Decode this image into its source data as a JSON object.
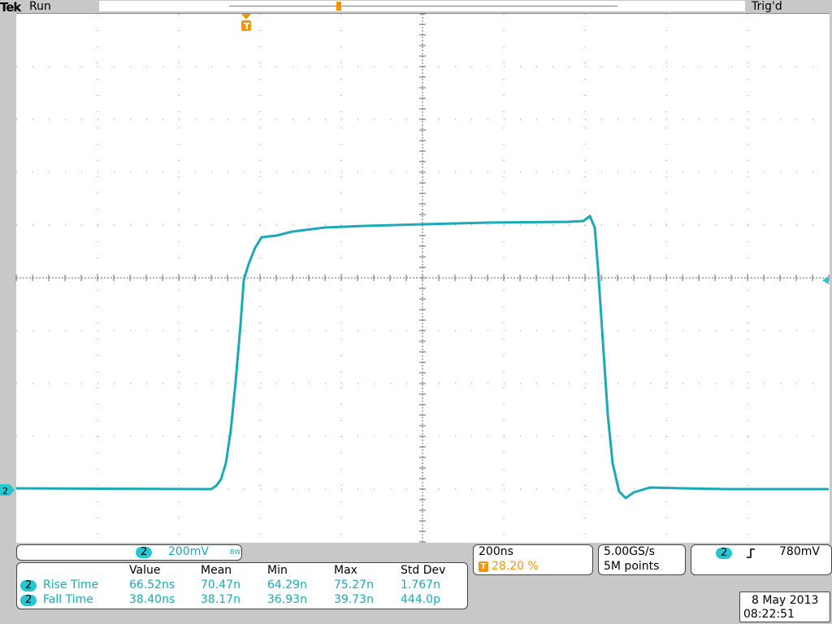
{
  "status": {
    "brand": "Tek",
    "run_state": "Run",
    "trigger_state": "Trig'd"
  },
  "trigger_marker": {
    "label": "T",
    "position_percent": 28.2
  },
  "channel": {
    "number": "2",
    "ground_label": "2",
    "volts_per_div": "200mV",
    "bw_label": "BW"
  },
  "timebase": {
    "per_div": "200ns",
    "trigger_position": "28.20 %"
  },
  "acquisition": {
    "sample_rate": "5.00GS/s",
    "record_length": "5M points"
  },
  "trigger": {
    "source": "2",
    "slope_icon": "rising-edge-icon",
    "level": "780mV"
  },
  "measurements": {
    "headers": [
      "Value",
      "Mean",
      "Min",
      "Max",
      "Std Dev"
    ],
    "rows": [
      {
        "channel": "2",
        "name": "Rise Time",
        "value": "66.52ns",
        "mean": "70.47n",
        "min": "64.29n",
        "max": "75.27n",
        "std_dev": "1.767n"
      },
      {
        "channel": "2",
        "name": "Fall Time",
        "value": "38.40ns",
        "mean": "38.17n",
        "min": "36.93n",
        "max": "39.73n",
        "std_dev": "444.0p"
      }
    ]
  },
  "datetime": {
    "date": "8 May 2013",
    "time": "08:22:51"
  },
  "colors": {
    "trace": "#1aa9b5",
    "trigger": "#f49400",
    "background": "#c8c8c8",
    "graticule": "#ffffff"
  }
}
